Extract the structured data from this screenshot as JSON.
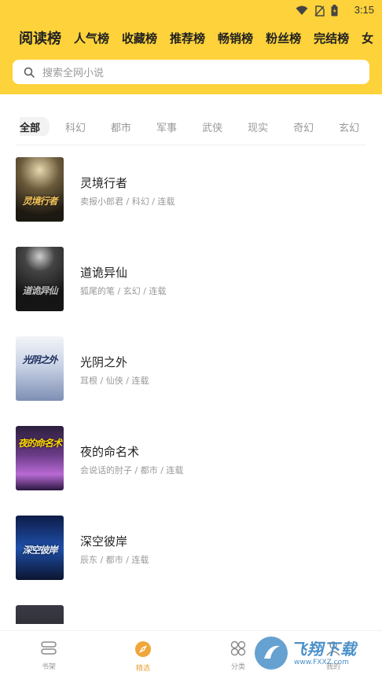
{
  "status_bar": {
    "time": "3:15"
  },
  "rank_tabs": [
    "阅读榜",
    "人气榜",
    "收藏榜",
    "推荐榜",
    "畅销榜",
    "粉丝榜",
    "完结榜",
    "女"
  ],
  "search": {
    "placeholder": "搜索全网小说"
  },
  "categories": [
    "全部",
    "科幻",
    "都市",
    "军事",
    "武侠",
    "现实",
    "奇幻",
    "玄幻"
  ],
  "books": [
    {
      "title": "灵境行者",
      "meta": "卖报小郎君 / 科幻 / 连载",
      "cover_text": "灵境行者"
    },
    {
      "title": "道诡异仙",
      "meta": "狐尾的笔 / 玄幻 / 连载",
      "cover_text": "道诡异仙"
    },
    {
      "title": "光阴之外",
      "meta": "耳根 / 仙侠 / 连载",
      "cover_text": "光阴之外"
    },
    {
      "title": "夜的命名术",
      "meta": "会说话的肘子 / 都市 / 连载",
      "cover_text": "夜的命名术"
    },
    {
      "title": "深空彼岸",
      "meta": "辰东 / 都市 / 连载",
      "cover_text": "深空彼岸"
    },
    {
      "title": "",
      "meta": "",
      "cover_text": ""
    }
  ],
  "bottom_nav": [
    {
      "label": "书架",
      "icon": "bookshelf-icon"
    },
    {
      "label": "精选",
      "icon": "compass-icon"
    },
    {
      "label": "分类",
      "icon": "category-icon"
    },
    {
      "label": "我的",
      "icon": "profile-icon"
    }
  ],
  "watermark": {
    "text": "飞翔下载",
    "sub": "www.FXXZ.com"
  },
  "colors": {
    "accent": "#fdd23a",
    "nav_active": "#e9a23b"
  }
}
